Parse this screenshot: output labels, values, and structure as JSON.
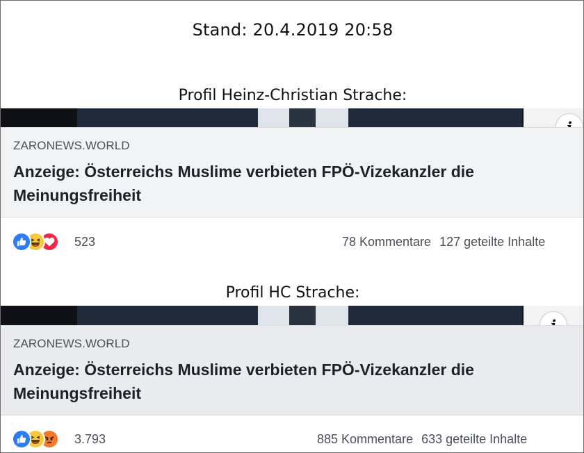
{
  "header": {
    "stand": "Stand: 20.4.2019  20:58"
  },
  "sections": [
    {
      "profile_title": "Profil Heinz-Christian Strache:",
      "post": {
        "domain": "ZARONEWS.WORLD",
        "headline": "Anzeige: Österreichs Muslime verbieten FPÖ-Vizekanzler die Meinungsfreiheit",
        "reactions": [
          "like",
          "haha",
          "love"
        ],
        "reaction_count": "523",
        "comments": "78 Kommentare",
        "shares": "127 geteilte Inhalte"
      }
    },
    {
      "profile_title": "Profil HC Strache:",
      "post": {
        "domain": "ZARONEWS.WORLD",
        "headline": "Anzeige: Österreichs Muslime verbieten FPÖ-Vizekanzler die Meinungsfreiheit",
        "reactions": [
          "like",
          "haha",
          "angry"
        ],
        "reaction_count": "3.793",
        "comments": "885 Kommentare",
        "shares": "633 geteilte Inhalte"
      }
    }
  ],
  "icons": {
    "info": "info-icon",
    "like": "like-reaction-icon",
    "haha": "haha-reaction-icon",
    "love": "love-reaction-icon",
    "angry": "angry-reaction-icon"
  },
  "colors": {
    "like": "#2d7cf6",
    "haha": "#f7c93e",
    "love": "#f0284a",
    "angry": "#f07a2a",
    "card_bg": "#f2f3f5"
  }
}
